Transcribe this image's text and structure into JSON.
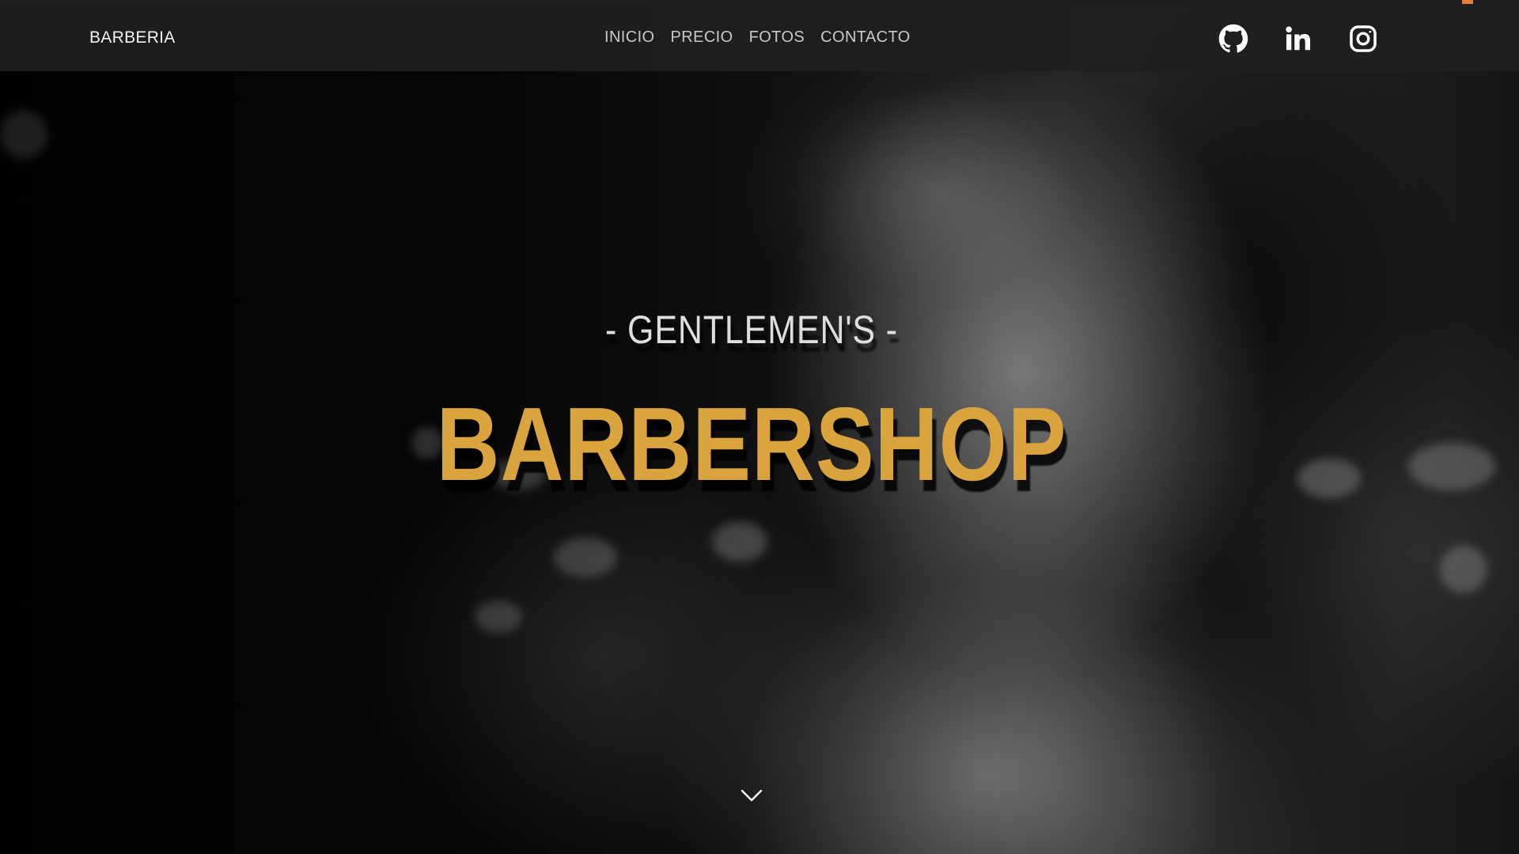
{
  "navbar": {
    "brand": "BARBERIA",
    "links": [
      {
        "label": "INICIO"
      },
      {
        "label": "PRECIO"
      },
      {
        "label": "FOTOS"
      },
      {
        "label": "CONTACTO"
      }
    ],
    "socials": [
      {
        "icon": "github-icon"
      },
      {
        "icon": "linkedin-icon"
      },
      {
        "icon": "instagram-icon"
      }
    ]
  },
  "hero": {
    "subtitle": "- GENTLEMEN'S -",
    "title": "BARBERSHOP",
    "scroll_icon": "chevron-down-icon"
  },
  "colors": {
    "accent": "#d9a33d",
    "navbar_bg": "#202020",
    "nav_text": "#c9c9c9"
  }
}
